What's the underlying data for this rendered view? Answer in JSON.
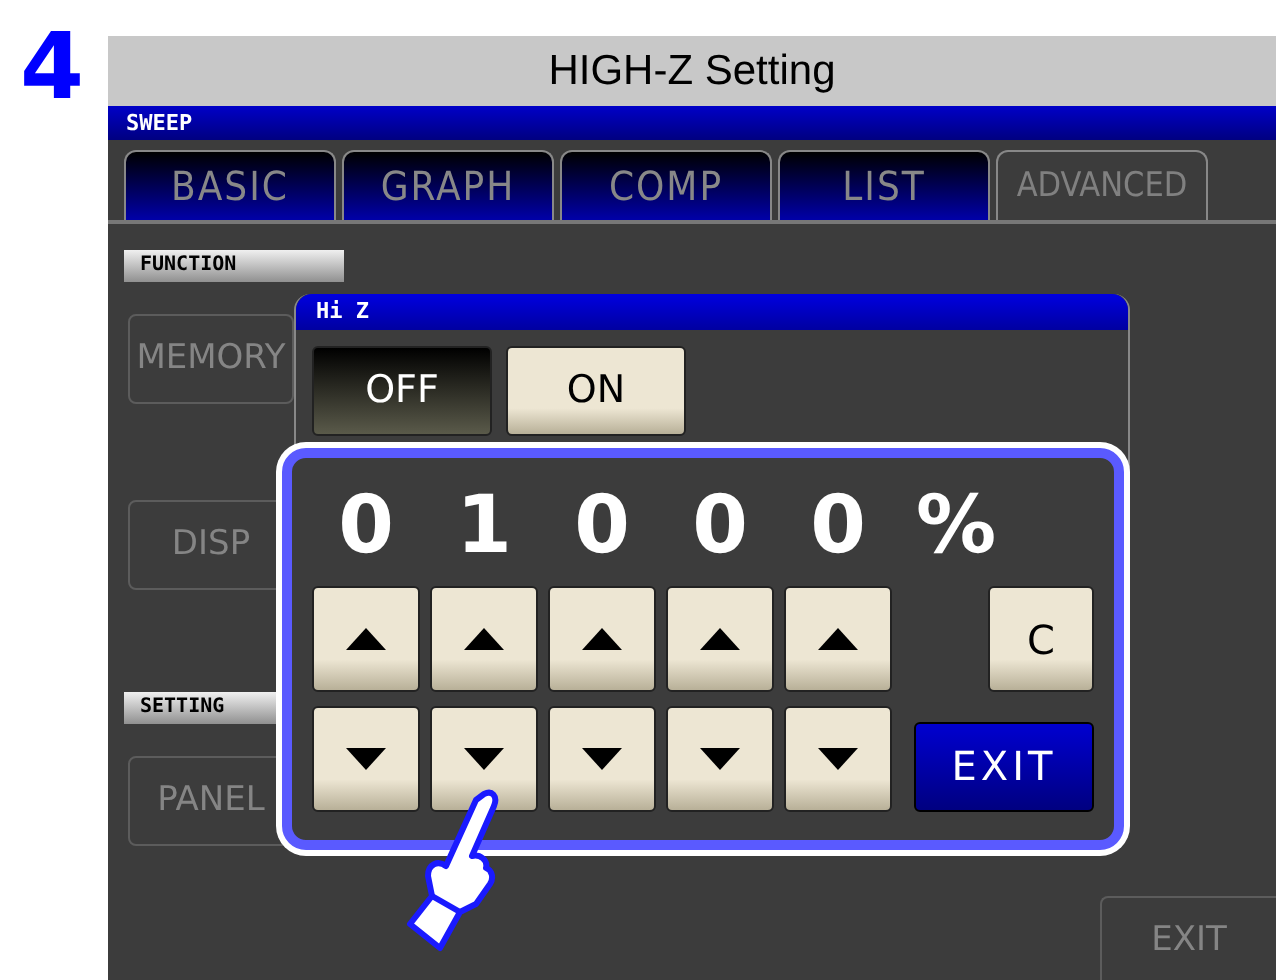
{
  "step": "4",
  "header": {
    "title": "HIGH-Z Setting"
  },
  "mode": "SWEEP",
  "tabs": [
    {
      "label": "BASIC",
      "selected": false
    },
    {
      "label": "GRAPH",
      "selected": false
    },
    {
      "label": "COMP",
      "selected": false
    },
    {
      "label": "LIST",
      "selected": false
    },
    {
      "label": "ADVANCED",
      "selected": true
    }
  ],
  "sections": [
    {
      "label": "FUNCTION",
      "buttons": [
        {
          "label": "MEMORY",
          "disabled": true
        },
        {
          "label": "DISP",
          "disabled": true
        }
      ]
    },
    {
      "label": "SETTING",
      "buttons": [
        {
          "label": "PANEL",
          "disabled": true
        }
      ]
    }
  ],
  "exit_button": {
    "label": "EXIT",
    "disabled": true
  },
  "dialog": {
    "title": "Hi Z",
    "options": [
      {
        "label": "OFF",
        "selected": true
      },
      {
        "label": "ON",
        "selected": false
      }
    ],
    "keypad": {
      "digits": [
        "0",
        "1",
        "0",
        "0",
        "0"
      ],
      "unit": "%",
      "clear": "C",
      "exit": "EXIT"
    }
  }
}
